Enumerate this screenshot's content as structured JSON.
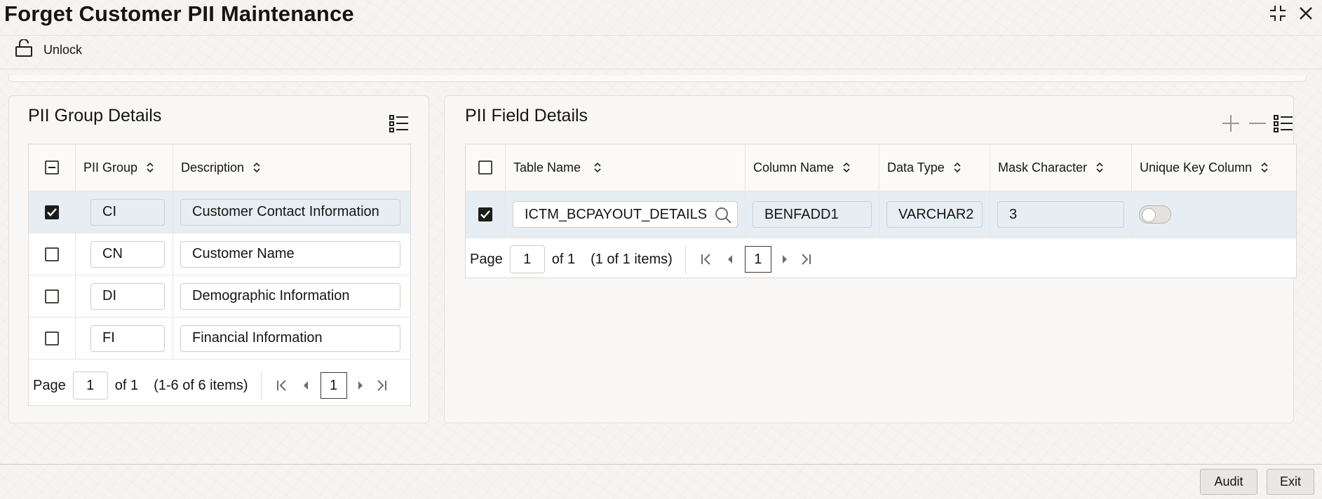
{
  "title": "Forget Customer PII Maintenance",
  "toolbar": {
    "unlock_label": "Unlock"
  },
  "group_panel": {
    "title": "PII Group Details",
    "columns": [
      "PII Group",
      "Description"
    ],
    "rows": [
      {
        "selected": true,
        "group": "CI",
        "description": "Customer Contact Information"
      },
      {
        "selected": false,
        "group": "CN",
        "description": "Customer Name"
      },
      {
        "selected": false,
        "group": "DI",
        "description": "Demographic Information"
      },
      {
        "selected": false,
        "group": "FI",
        "description": "Financial Information"
      }
    ],
    "pager": {
      "page_label": "Page",
      "page": "1",
      "of_label": "of 1",
      "items_label": "(1-6 of 6 items)",
      "current": "1"
    }
  },
  "field_panel": {
    "title": "PII Field Details",
    "columns": [
      "Table Name",
      "Column Name",
      "Data Type",
      "Mask Character",
      "Unique Key Column"
    ],
    "rows": [
      {
        "selected": true,
        "table_name": "ICTM_BCPAYOUT_DETAILS",
        "column_name": "BENFADD1",
        "data_type": "VARCHAR2",
        "mask_character": "3",
        "unique_key": false
      }
    ],
    "pager": {
      "page_label": "Page",
      "page": "1",
      "of_label": "of 1",
      "items_label": "(1 of 1 items)",
      "current": "1"
    }
  },
  "footer": {
    "audit_label": "Audit",
    "exit_label": "Exit"
  },
  "colors": {
    "selected_row": "#e6eef3",
    "text": "#161513",
    "border": "#e1dfdc"
  },
  "icons": [
    "minimize-icon",
    "close-icon",
    "unlock-icon",
    "column-manager-icon",
    "add-row-icon",
    "remove-row-icon",
    "sort-icon",
    "search-icon",
    "first-page-icon",
    "previous-page-icon",
    "next-page-icon",
    "last-page-icon"
  ]
}
